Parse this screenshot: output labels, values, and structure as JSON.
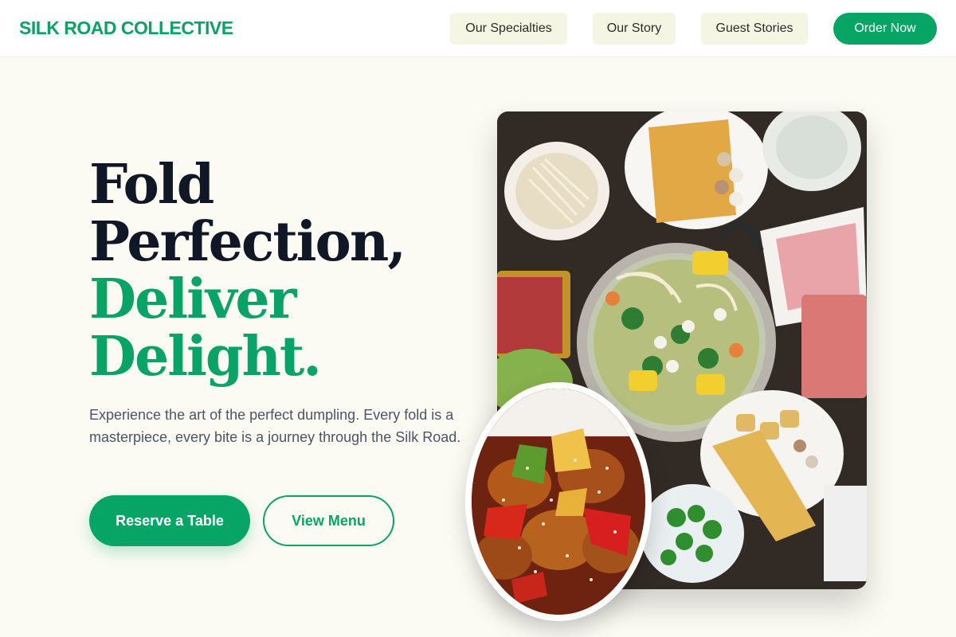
{
  "header": {
    "brand": "SILK ROAD COLLECTIVE",
    "nav": [
      "Our Specialties",
      "Our Story",
      "Guest Stories"
    ],
    "cta": "Order Now"
  },
  "hero": {
    "headline_dark": [
      "Fold",
      "Perfection,"
    ],
    "headline_green": [
      "Deliver",
      "Delight."
    ],
    "lede": "Experience the art of the perfect dumpling. Every fold is a masterpiece, every bite is a journey through the Silk Road.",
    "primary_button": "Reserve a Table",
    "secondary_button": "View Menu"
  },
  "images": {
    "main": "hot-pot-spread-photo",
    "inset": "sweet-sour-chicken-photo"
  },
  "colors": {
    "brand_green": "#0aa366",
    "headline_dark": "#101827",
    "background": "#fbfbf4",
    "nav_button_bg": "#f4f5e3"
  }
}
